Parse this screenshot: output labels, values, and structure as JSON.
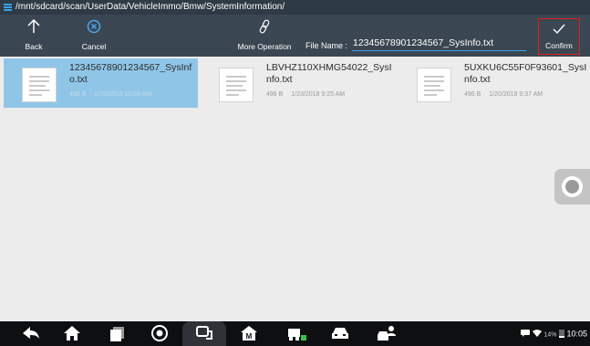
{
  "path_bar": {
    "path": "/mnt/sdcard/scan/UserData/VehicleImmo/Bmw/SystemInformation/"
  },
  "toolbar": {
    "back_label": "Back",
    "cancel_label": "Cancel",
    "more_label": "More Operation",
    "file_name_label": "File Name :",
    "file_name_value": "12345678901234567_SysInfo.txt",
    "confirm_label": "Confirm"
  },
  "files": [
    {
      "name": "12345678901234567_SysInfo.txt",
      "size": "496 B",
      "date": "1/26/2018 10:03 AM",
      "selected": true
    },
    {
      "name": "LBVHZ110XHMG54022_SysInfo.txt",
      "size": "496 B",
      "date": "1/23/2018 9:25 AM",
      "selected": false
    },
    {
      "name": "5UXKU6C55F0F93601_SysInfo.txt",
      "size": "496 B",
      "date": "1/20/2018 9:37 AM",
      "selected": false
    }
  ],
  "nav_icons": [
    "back-arrow-icon",
    "home-icon",
    "recent-apps-icon",
    "browser-icon",
    "vci-connector-icon",
    "diag-home-icon",
    "vehicle-service-icon",
    "car-icon",
    "user-car-icon"
  ],
  "status": {
    "battery": "14%",
    "time": "10:05"
  },
  "colors": {
    "toolbar_bg": "#3a4651",
    "accent": "#3aa0e8",
    "selection": "#8fc6e8",
    "confirm_highlight": "#e02020"
  }
}
